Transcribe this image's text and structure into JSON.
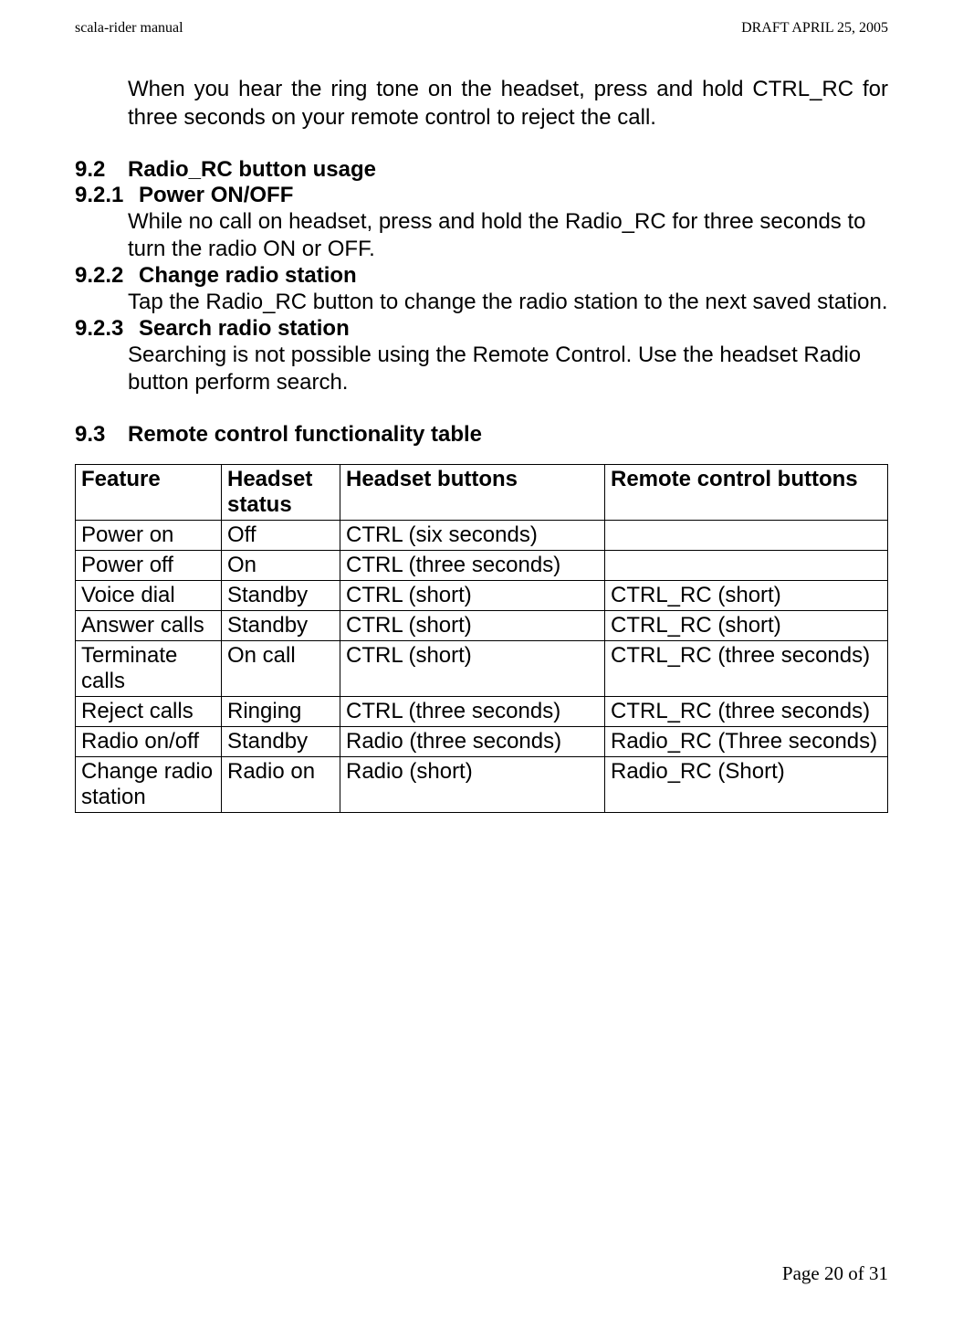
{
  "header": {
    "left": "scala-rider manual",
    "right": "DRAFT  APRIL 25, 2005"
  },
  "intro": "When you hear the ring tone on the headset, press and hold CTRL_RC for three seconds on your remote control to reject the call.",
  "sections": {
    "s92_num": "9.2",
    "s92_title": "Radio_RC button usage",
    "s921_num": "9.2.1",
    "s921_title": "Power ON/OFF",
    "s921_body": "While no call on headset, press and hold the Radio_RC for three seconds to turn the radio ON or OFF.",
    "s922_num": "9.2.2",
    "s922_title": "Change radio station",
    "s922_body": "Tap the Radio_RC button to change the radio station to the next saved station.",
    "s923_num": "9.2.3",
    "s923_title": "Search radio station",
    "s923_body": "Searching is not possible using the Remote Control. Use the headset Radio button perform search.",
    "s93_num": "9.3",
    "s93_title": "Remote control functionality table"
  },
  "table": {
    "headers": {
      "feature": "Feature",
      "status": "Headset status",
      "hbtn": "Headset buttons",
      "rbtn": "Remote control buttons"
    },
    "rows": [
      {
        "feature": "Power on",
        "status": "Off",
        "hbtn": "CTRL (six seconds)",
        "rbtn": ""
      },
      {
        "feature": "Power off",
        "status": "On",
        "hbtn": "CTRL (three  seconds)",
        "rbtn": ""
      },
      {
        "feature": "Voice dial",
        "status": "Standby",
        "hbtn": "CTRL (short)",
        "rbtn": "CTRL_RC (short)"
      },
      {
        "feature": "Answer calls",
        "status": "Standby",
        "hbtn": "CTRL (short)",
        "rbtn": "CTRL_RC (short)"
      },
      {
        "feature": "Terminate calls",
        "status": "On call",
        "hbtn": "CTRL (short)",
        "rbtn": "CTRL_RC (three  seconds)"
      },
      {
        "feature": "Reject calls",
        "status": "Ringing",
        "hbtn": "CTRL (three  seconds)",
        "rbtn": "CTRL_RC (three  seconds)"
      },
      {
        "feature": "Radio on/off",
        "status": "Standby",
        "hbtn": "Radio (three  seconds)",
        "rbtn": "Radio_RC (Three seconds)"
      },
      {
        "feature": "Change radio station",
        "status": "Radio on",
        "hbtn": "Radio (short)",
        "rbtn": "Radio_RC (Short)"
      }
    ]
  },
  "footer": "Page 20 of 31"
}
